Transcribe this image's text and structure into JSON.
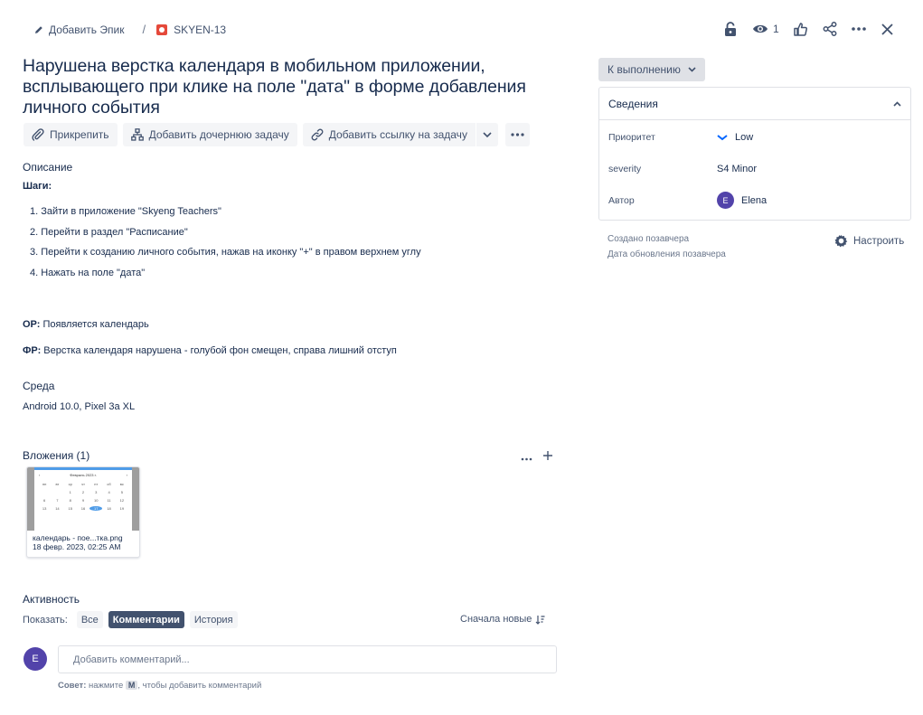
{
  "header": {
    "add_epic": "Добавить Эпик",
    "separator": "/",
    "issue_key": "SKYEN-13",
    "watch_count": "1"
  },
  "issue": {
    "title": "Нарушена верстка календаря в мобильном приложении, всплывающего при клике на поле \"дата\" в форме добавления личного события"
  },
  "toolbar": {
    "attach": "Прикрепить",
    "add_child": "Добавить дочернюю задачу",
    "add_link": "Добавить ссылку на задачу"
  },
  "description": {
    "label": "Описание",
    "steps_heading": "Шаги:",
    "steps": [
      "1. Зайти в приложение \"Skyeng Teachers\"",
      "2. Перейти в раздел \"Расписание\"",
      "3. Перейти к созданию личного события, нажав на иконку \"+\" в правом верхнем углу",
      "4. Нажать на поле \"дата\""
    ],
    "expected_label": "ОР:",
    "expected_text": " Появляется календарь",
    "actual_label": "ФР:",
    "actual_text": " Верстка календаря нарушена - голубой фон смещен, справа лишний отступ"
  },
  "environment": {
    "label": "Среда",
    "value": "Android 10.0, Pixel 3a XL"
  },
  "attachments": {
    "label": "Вложения (1)",
    "items": [
      {
        "name": "календарь - пое...тка.png",
        "date": "18 февр. 2023, 02:25 AM",
        "image_title": "Февраль 2023 г."
      }
    ]
  },
  "activity": {
    "label": "Активность",
    "show_label": "Показать:",
    "filters": [
      "Все",
      "Комментарии",
      "История"
    ],
    "active_filter": "Комментарии",
    "sort": "Сначала новые",
    "avatar_initial": "E",
    "comment_placeholder": "Добавить комментарий...",
    "tip_label": "Совет:",
    "tip_before": " нажмите ",
    "tip_key": "M",
    "tip_after": ", чтобы добавить комментарий"
  },
  "sidebar": {
    "status": "К выполнению",
    "details_title": "Сведения",
    "fields": [
      {
        "key": "Приоритет",
        "value": "Low"
      },
      {
        "key": "severity",
        "value": "S4 Minor"
      },
      {
        "key": "Автор",
        "value": "Elena",
        "initial": "E"
      }
    ],
    "created": "Создано позавчера",
    "updated": "Дата обновления позавчера",
    "configure": "Настроить"
  },
  "colors": {
    "text": "#172b4d",
    "subtle": "#42526e",
    "avatar": "#5243aa",
    "bug": "#e5493a",
    "priority_low": "#0065ff"
  }
}
